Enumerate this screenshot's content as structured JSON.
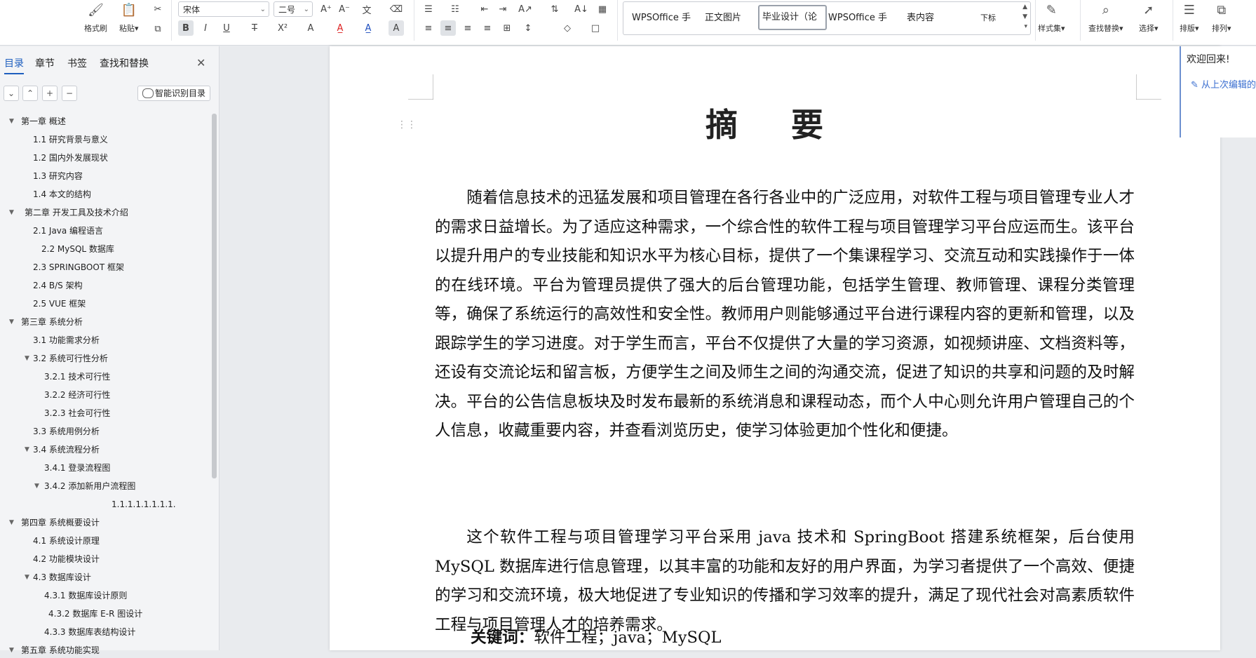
{
  "ribbon": {
    "format_brush": "格式刷",
    "paste": "粘贴",
    "font_name": "宋体",
    "font_size": "二号",
    "styles": [
      "WPSOffice 手",
      "正文图片",
      "毕业设计（论",
      "WPSOffice 手",
      "表内容",
      "下标"
    ],
    "style_set": "样式集",
    "find_replace": "查找替换",
    "select": "选择",
    "layout": "排版",
    "arrange": "排列"
  },
  "nav": {
    "tabs": [
      "目录",
      "章节",
      "书签",
      "查找和替换"
    ],
    "smart_btn": "智能识别目录",
    "toc": [
      "第一章 概述",
      "1.1 研究背景与意义",
      "1.2 国内外发展现状",
      "1.3 研究内容",
      "1.4 本文的结构",
      "第二章 开发工具及技术介绍",
      "2.1 Java 编程语言",
      "2.2 MySQL 数据库",
      "2.3 SPRINGBOOT 框架",
      "2.4 B/S 架构",
      "2.5 VUE 框架",
      "第三章 系统分析",
      "3.1 功能需求分析",
      "3.2 系统可行性分析",
      "3.2.1 技术可行性",
      "3.2.2 经济可行性",
      "3.2.3 社会可行性",
      "3.3 系统用例分析",
      "3.4 系统流程分析",
      "3.4.1 登录流程图",
      "3.4.2 添加新用户流程图",
      "1.1.1.1.1.1.1.1.",
      "第四章 系统概要设计",
      "4.1 系统设计原理",
      "4.2 功能模块设计",
      "4.3 数据库设计",
      "4.3.1 数据库设计原则",
      "4.3.2 数据库 E-R 图设计",
      "4.3.3 数据库表结构设计",
      "第五章 系统功能实现"
    ]
  },
  "document": {
    "title": "摘 要",
    "para1": "随着信息技术的迅猛发展和项目管理在各行各业中的广泛应用，对软件工程与项目管理专业人才的需求日益增长。为了适应这种需求，一个综合性的软件工程与项目管理学习平台应运而生。该平台以提升用户的专业技能和知识水平为核心目标，提供了一个集课程学习、交流互动和实践操作于一体的在线环境。平台为管理员提供了强大的后台管理功能，包括学生管理、教师管理、课程分类管理等，确保了系统运行的高效性和安全性。教师用户则能够通过平台进行课程内容的更新和管理，以及跟踪学生的学习进度。对于学生而言，平台不仅提供了大量的学习资源，如视频讲座、文档资料等，还设有交流论坛和留言板，方便学生之间及师生之间的沟通交流，促进了知识的共享和问题的及时解决。平台的公告信息板块及时发布最新的系统消息和课程动态，而个人中心则允许用户管理自己的个人信息，收藏重要内容，并查看浏览历史，使学习体验更加个性化和便捷。",
    "para2": "这个软件工程与项目管理学习平台采用 java 技术和 SpringBoot 搭建系统框架，后台使用 MySQL 数据库进行信息管理，以其丰富的功能和友好的用户界面，为学习者提供了一个高效、便捷的学习和交流环境，极大地促进了专业知识的传播和学习效率的提升，满足了现代社会对高素质软件工程与项目管理人才的培养需求。",
    "keywords_label": "关键词：",
    "keywords": "软件工程；java；MySQL"
  },
  "welcome": {
    "title": "欢迎回来!",
    "link": "从上次编辑的"
  }
}
